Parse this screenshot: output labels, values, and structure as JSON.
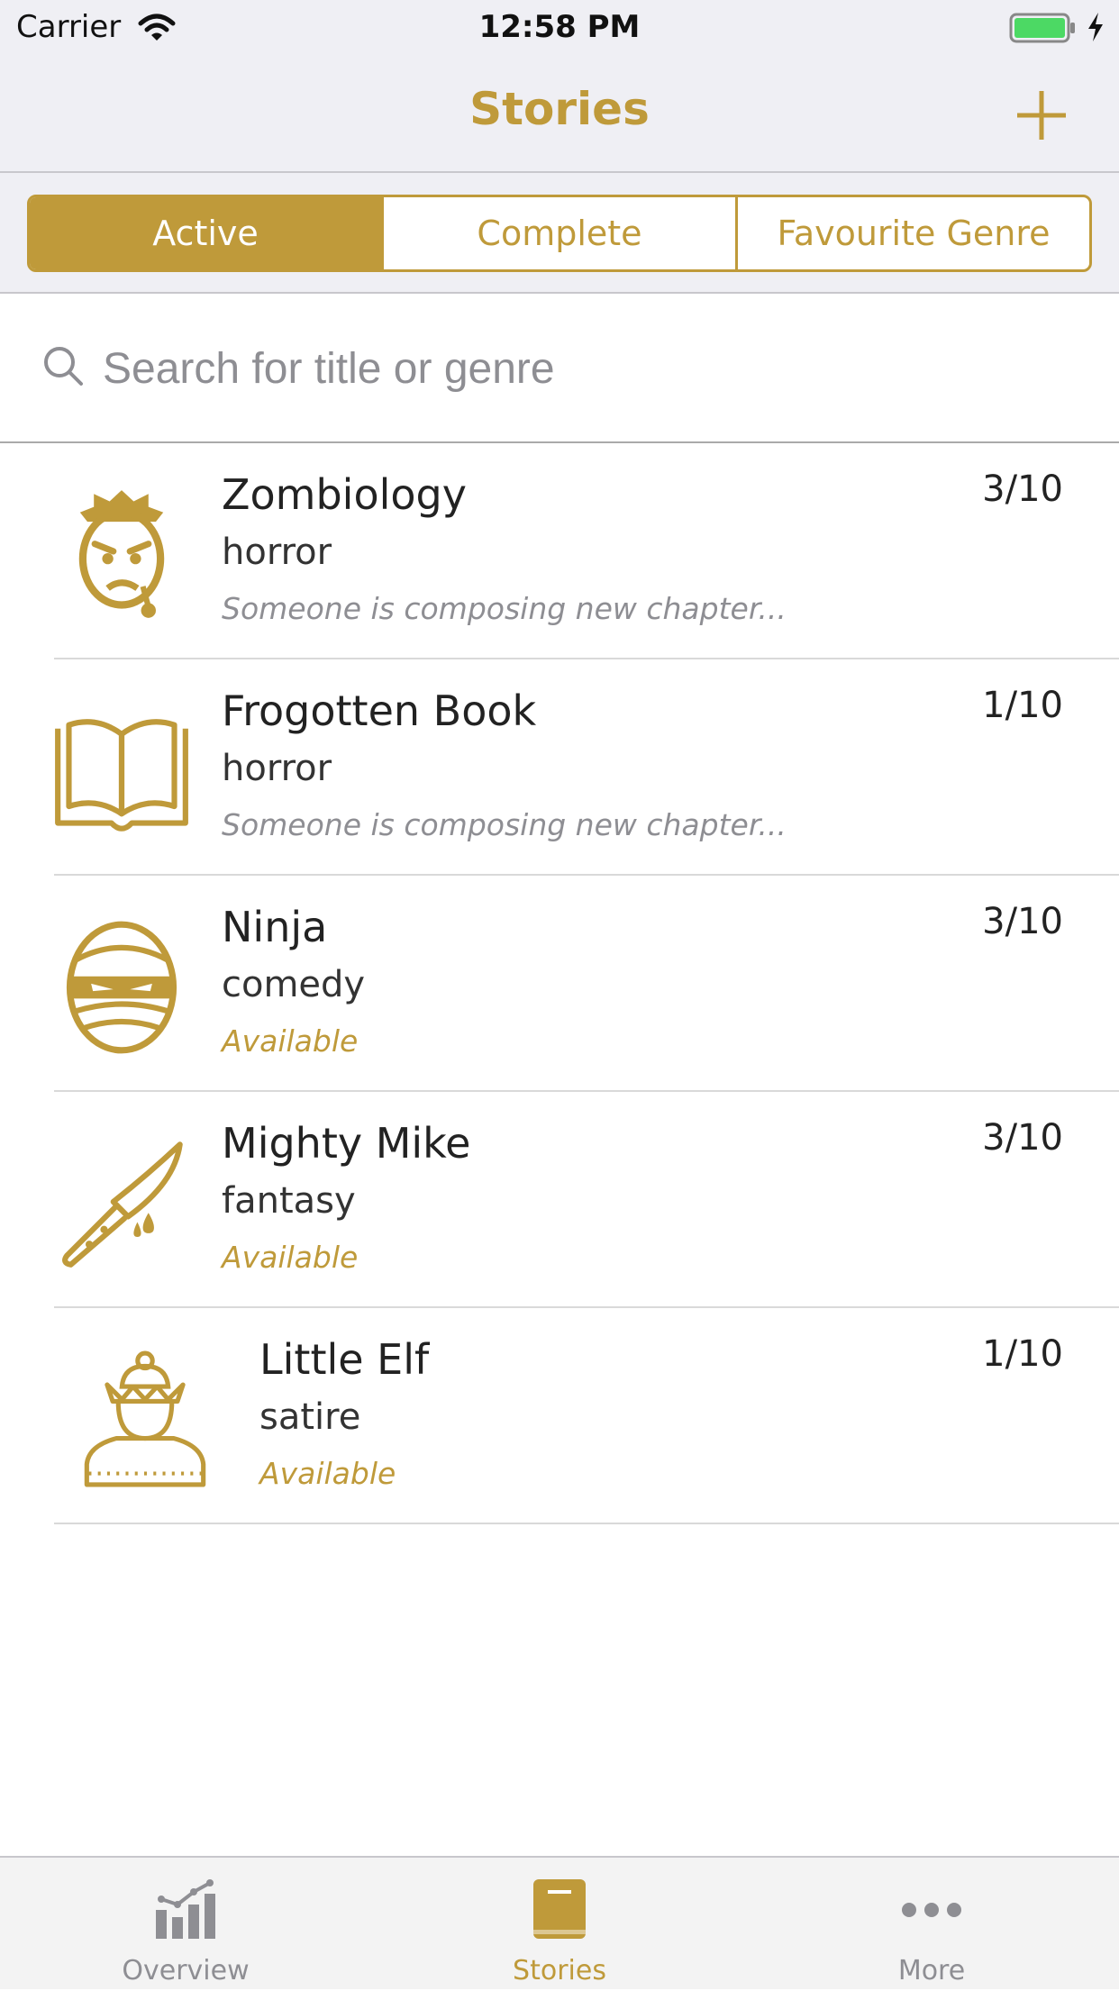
{
  "status_bar": {
    "carrier": "Carrier",
    "time": "12:58 PM"
  },
  "nav": {
    "title": "Stories"
  },
  "segments": [
    "Active",
    "Complete",
    "Favourite Genre"
  ],
  "search": {
    "placeholder": "Search for title or genre"
  },
  "stories": [
    {
      "title": "Zombiology",
      "genre": "horror",
      "status": "Someone is composing new chapter...",
      "count": "3/10",
      "icon": "zombie-face-icon"
    },
    {
      "title": "Frogotten Book",
      "genre": "horror",
      "status": "Someone is composing new chapter...",
      "count": "1/10",
      "icon": "open-book-icon"
    },
    {
      "title": "Ninja",
      "genre": "comedy",
      "status": "Available",
      "count": "3/10",
      "icon": "ninja-mask-icon"
    },
    {
      "title": "Mighty Mike",
      "genre": "fantasy",
      "status": "Available",
      "count": "3/10",
      "icon": "bloody-knife-icon"
    },
    {
      "title": "Little Elf",
      "genre": "satire",
      "status": "Available",
      "count": "1/10",
      "icon": "elf-icon"
    }
  ],
  "tabs": [
    {
      "label": "Overview",
      "icon": "chart-icon"
    },
    {
      "label": "Stories",
      "icon": "book-icon"
    },
    {
      "label": "More",
      "icon": "ellipsis-icon"
    }
  ],
  "colors": {
    "accent": "#bf9a3a",
    "bar_background": "#efeff4",
    "secondary_text": "#8e8e93"
  }
}
